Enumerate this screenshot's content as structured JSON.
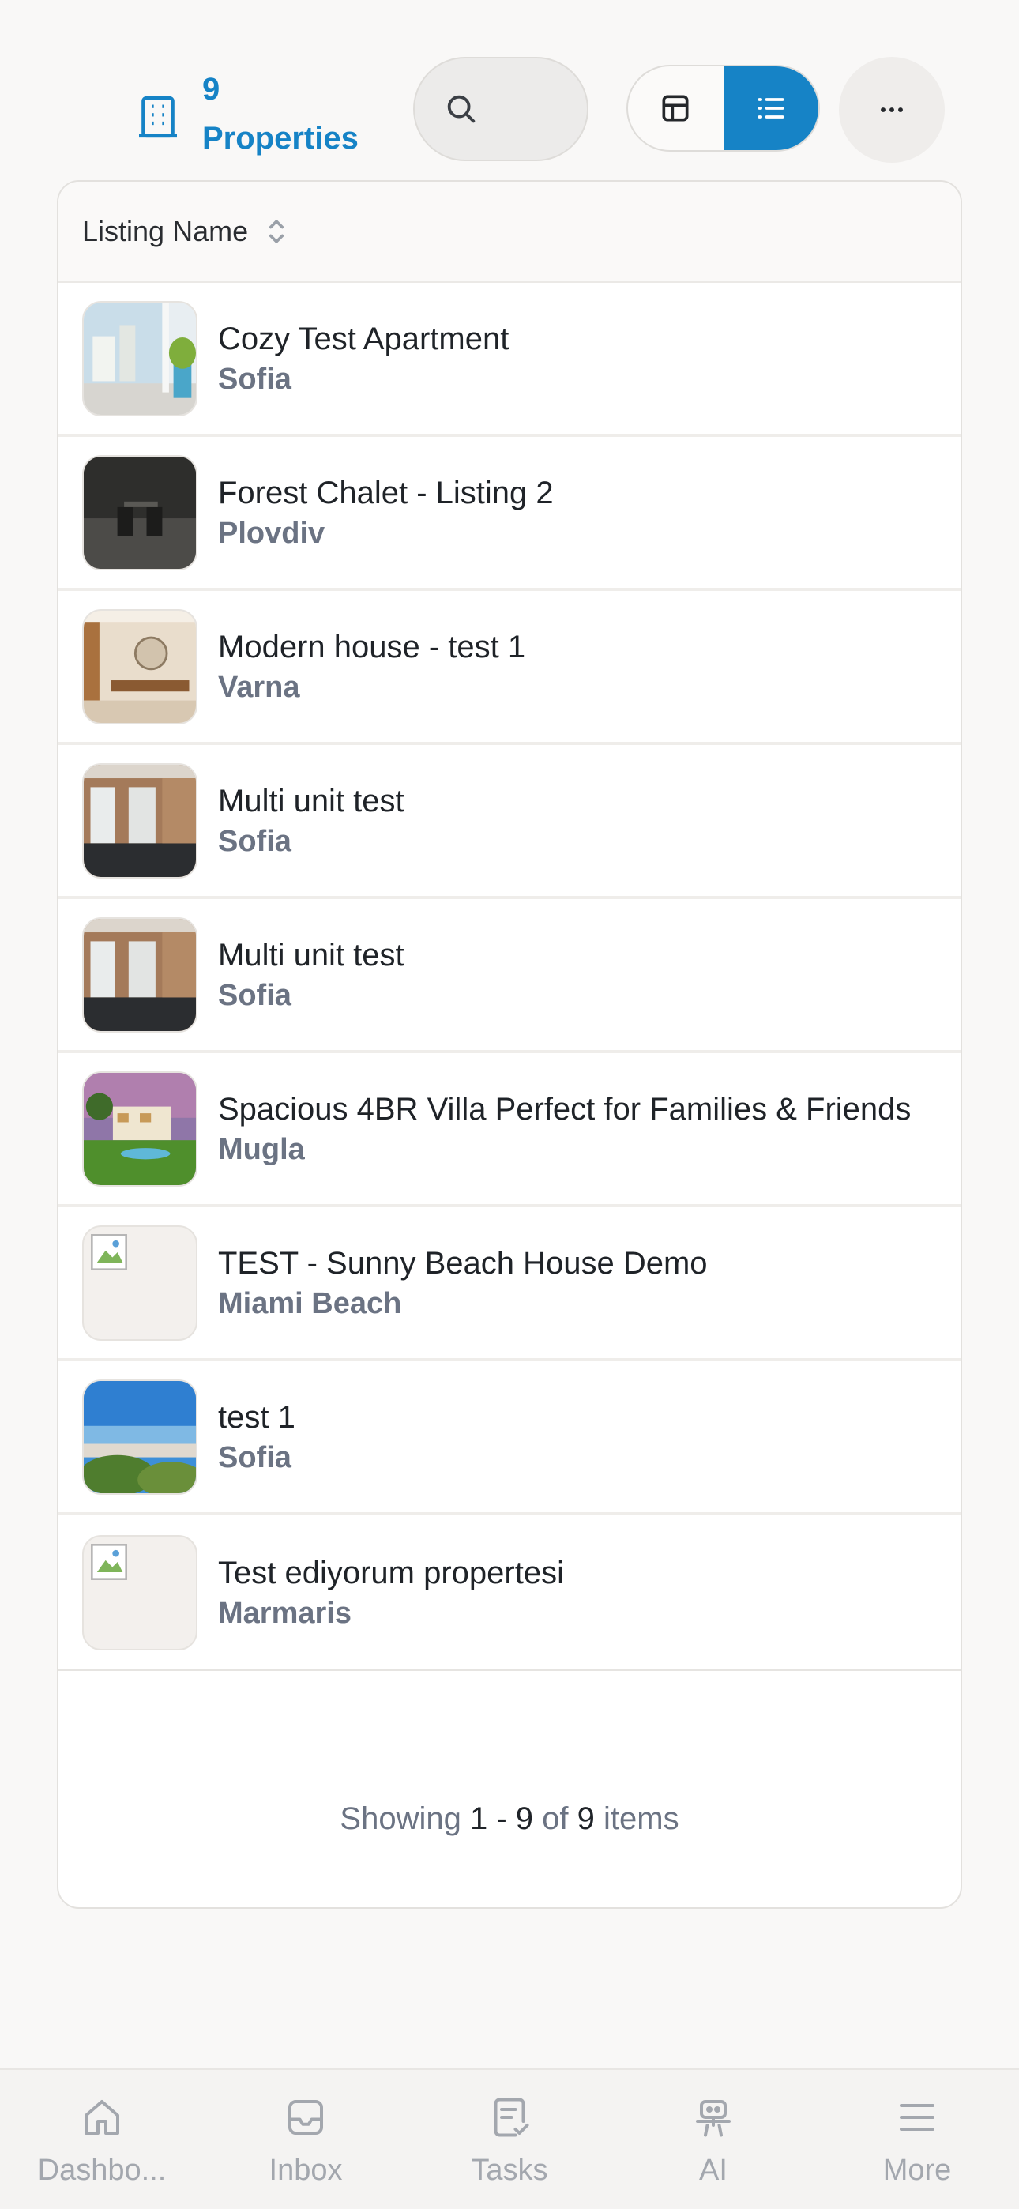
{
  "header": {
    "count": "9",
    "count_label": "Properties"
  },
  "table": {
    "column_header": "Listing Name",
    "rows": [
      {
        "name": "Cozy Test Apartment",
        "city": "Sofia",
        "image": "apartment-window-photo"
      },
      {
        "name": "Forest Chalet - Listing 2",
        "city": "Plovdiv",
        "image": "dark-room-photo"
      },
      {
        "name": "Modern house - test 1",
        "city": "Varna",
        "image": "modern-interior-photo"
      },
      {
        "name": "Multi unit test",
        "city": "Sofia",
        "image": "empty-room-photo"
      },
      {
        "name": "Multi unit test",
        "city": "Sofia",
        "image": "empty-room-photo"
      },
      {
        "name": "Spacious 4BR Villa Perfect for Families & Friends",
        "city": "Mugla",
        "image": "villa-photo"
      },
      {
        "name": "TEST - Sunny Beach House Demo",
        "city": "Miami Beach",
        "image": "broken-image"
      },
      {
        "name": "test 1",
        "city": "Sofia",
        "image": "coastal-city-photo"
      },
      {
        "name": "Test ediyorum propertesi",
        "city": "Marmaris",
        "image": "broken-image"
      }
    ]
  },
  "pagination": {
    "prefix": "Showing",
    "start": "1",
    "dash": "-",
    "end": "9",
    "of": "of",
    "total": "9",
    "suffix": "items"
  },
  "nav": {
    "items": [
      {
        "label": "Dashbo...",
        "icon": "home-icon"
      },
      {
        "label": "Inbox",
        "icon": "inbox-icon"
      },
      {
        "label": "Tasks",
        "icon": "tasks-icon"
      },
      {
        "label": "AI",
        "icon": "robot-icon"
      },
      {
        "label": "More",
        "icon": "menu-icon"
      }
    ]
  },
  "colors": {
    "accent": "#1683c6",
    "muted_text": "#6b7383",
    "nav_text": "#a3a7ae"
  }
}
